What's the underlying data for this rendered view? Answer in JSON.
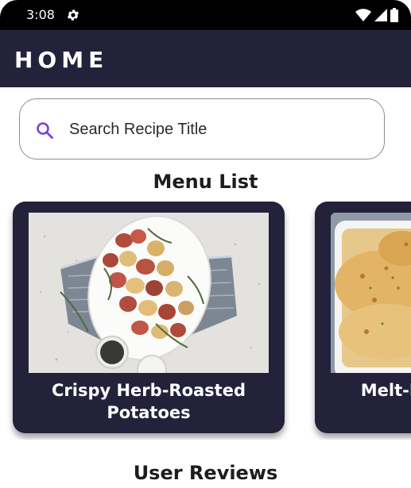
{
  "status_bar": {
    "time": "3:08",
    "icons": [
      "gear-icon",
      "wifi-icon",
      "signal-icon",
      "battery-icon"
    ]
  },
  "app_bar": {
    "title": "HOME"
  },
  "search": {
    "placeholder": "Search Recipe Title",
    "value": "",
    "icon": "search-icon"
  },
  "menu": {
    "title": "Menu List",
    "items": [
      {
        "name": "Crispy Herb-Roasted Potatoes"
      },
      {
        "name": "Melt-In-Your-Mouth Chicken"
      }
    ]
  },
  "reviews": {
    "title": "User Reviews"
  },
  "colors": {
    "app_bar": "#23223a",
    "card": "#23223a",
    "accent": "#7b3fe4",
    "status_bar": "#000000"
  }
}
